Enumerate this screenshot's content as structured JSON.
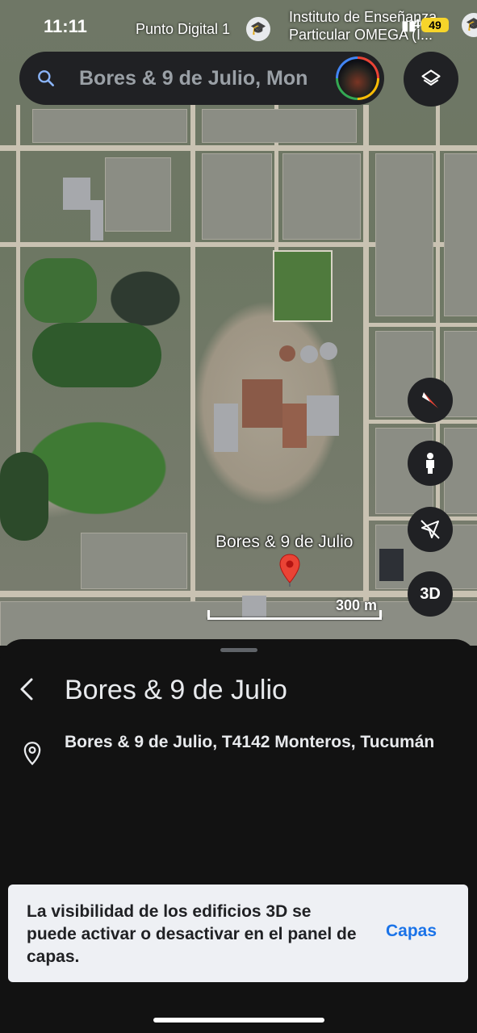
{
  "status_bar": {
    "time": "11:11",
    "network": "4G",
    "battery": "49"
  },
  "map_pois": [
    {
      "label": "Punto Digital 1"
    },
    {
      "label": "Instituto de Enseñanza\nParticular OMEGA (I..."
    }
  ],
  "search": {
    "value": "Bores & 9 de Julio, Mon"
  },
  "map": {
    "pin_label": "Bores & 9 de Julio",
    "scale_label": "300 m"
  },
  "fabs": {
    "three_d": "3D"
  },
  "place": {
    "title": "Bores & 9 de Julio",
    "address": "Bores & 9 de Julio, T4142 Monteros, Tucumán"
  },
  "toast": {
    "message": "La visibilidad de los edificios 3D se puede activar o desactivar en el panel de capas.",
    "action": "Capas"
  },
  "colors": {
    "accent": "#1a73e8",
    "pin": "#ea4335",
    "sheet_bg": "#121212"
  }
}
